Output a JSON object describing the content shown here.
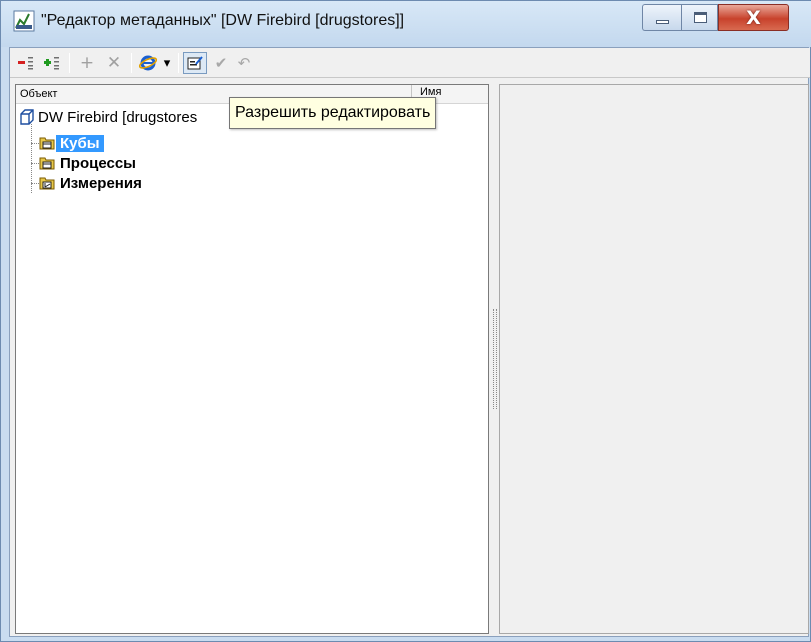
{
  "window": {
    "title": "\"Редактор метаданных\" [DW Firebird [drugstores]]",
    "icon": "metadata-editor-icon",
    "controls": {
      "minimize": "minimize-icon",
      "maximize": "maximize-icon",
      "close_label": "X"
    }
  },
  "toolbar": {
    "buttons": [
      {
        "name": "collapse-tree-button",
        "icon": "collapse-icon",
        "enabled": true
      },
      {
        "name": "expand-tree-button",
        "icon": "expand-icon",
        "enabled": true
      },
      {
        "name": "add-button",
        "label": "+",
        "enabled": false
      },
      {
        "name": "delete-button",
        "label": "✕",
        "enabled": false
      },
      {
        "name": "browser-button",
        "icon": "ie-icon",
        "enabled": true
      },
      {
        "name": "browser-dropdown-button",
        "label": "▾",
        "enabled": true
      },
      {
        "name": "allow-edit-button",
        "icon": "edit-form-icon",
        "enabled": true
      },
      {
        "name": "apply-button",
        "label": "✔",
        "enabled": false
      },
      {
        "name": "undo-button",
        "label": "↶",
        "enabled": false
      }
    ]
  },
  "tree": {
    "columns": {
      "object": "Объект",
      "name": "Имя"
    },
    "root": {
      "label": "DW Firebird [drugstores",
      "icon": "cube-icon"
    },
    "children": [
      {
        "label": "Кубы",
        "icon": "folder-table-icon",
        "selected": true
      },
      {
        "label": "Процессы",
        "icon": "folder-table-icon",
        "selected": false
      },
      {
        "label": "Измерения",
        "icon": "folder-dimension-icon",
        "selected": false
      }
    ]
  },
  "tooltip": {
    "text": "Разрешить редактировать"
  },
  "colors": {
    "selection": "#3399ff",
    "tooltip_bg": "#ffffe1",
    "close_button": "#c8422c"
  }
}
